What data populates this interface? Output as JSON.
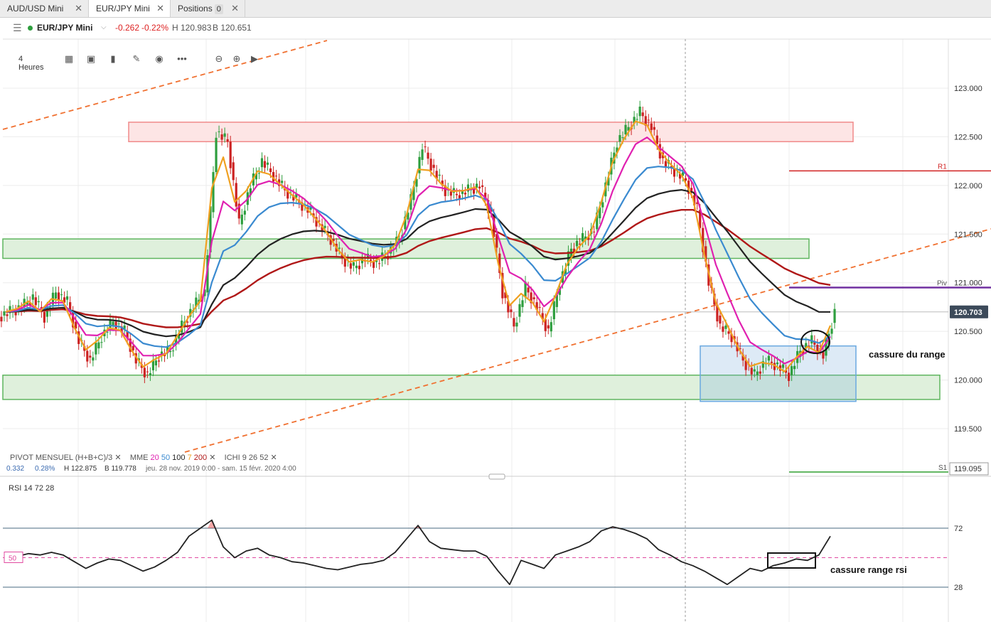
{
  "tabs": [
    {
      "label": "AUD/USD Mini",
      "active": false
    },
    {
      "label": "EUR/JPY Mini",
      "active": true
    },
    {
      "label": "Positions",
      "badge": "0",
      "active": false
    }
  ],
  "header": {
    "symbol": "EUR/JPY Mini",
    "change": "-0.262",
    "change_pct": "-0.22%",
    "high": "H 120.983",
    "bid": "B 120.651"
  },
  "toolbar": {
    "timeframe": "4 Heures",
    "icons": [
      "candles-icon",
      "layout-icon",
      "bar-chart-icon",
      "pencil-icon",
      "eye-icon",
      "more-icon",
      "zoom-out-icon",
      "zoom-in-icon",
      "play-icon"
    ]
  },
  "indicators": {
    "pivot": {
      "name": "PIVOT",
      "period": "MENSUEL",
      "formula": "(H+B+C)/3"
    },
    "mme": {
      "name": "MME",
      "periods": [
        "20",
        "50",
        "100",
        "7",
        "200"
      ]
    },
    "ichi": {
      "name": "ICHI",
      "params": [
        "9",
        "26",
        "52"
      ]
    },
    "rsi": {
      "name": "RSI",
      "params": [
        "14",
        "72",
        "28"
      ]
    }
  },
  "ohlc_line": {
    "val1": "0.332",
    "val2": "0.28%",
    "high": "H 122.875",
    "low": "B 119.778",
    "range": "jeu. 28 nov. 2019 0:00 - sam. 15 févr. 2020 4:00"
  },
  "colors": {
    "up": "#2e9e3e",
    "down": "#cc2222",
    "ema7": "#f0a020",
    "ema20": "#e020b0",
    "ema50": "#3a8ad0",
    "ema100": "#222222",
    "ema200": "#b01818",
    "pivot": "#7030a0",
    "r1": "#d02020",
    "s1": "#30a030",
    "trend": "#f07030"
  },
  "chart_data": {
    "type": "candlestick",
    "symbol": "EUR/JPY Mini",
    "timeframe": "4 Heures",
    "y_ticks": [
      123.0,
      122.5,
      122.0,
      121.5,
      121.0,
      120.5,
      120.0,
      119.5
    ],
    "y_tick_labels": [
      "123.000",
      "122.500",
      "122.000",
      "121.500",
      "121.000",
      "120.500",
      "120.000",
      "119.500"
    ],
    "ylim": [
      119.15,
      123.5
    ],
    "current_price": "120.703",
    "levels": {
      "R1": 122.15,
      "Piv": 120.95,
      "S1": 119.095
    },
    "level_labels": {
      "R1": "R1",
      "Piv": "Piv",
      "S1": "S1",
      "s1_value": "119.095"
    },
    "zones": [
      {
        "type": "resistance",
        "from": 122.45,
        "to": 122.65
      },
      {
        "type": "support",
        "from": 121.25,
        "to": 121.45
      },
      {
        "type": "support",
        "from": 119.8,
        "to": 120.05
      },
      {
        "type": "range",
        "from": 119.78,
        "to": 120.35
      }
    ],
    "closes": [
      120.7,
      120.75,
      120.85,
      120.65,
      120.9,
      120.8,
      120.4,
      120.2,
      120.45,
      120.6,
      120.5,
      120.2,
      120.05,
      120.25,
      120.3,
      120.55,
      120.75,
      120.9,
      122.55,
      122.45,
      121.6,
      122.0,
      122.25,
      122.1,
      121.95,
      121.85,
      121.75,
      121.6,
      121.45,
      121.25,
      121.15,
      121.25,
      121.2,
      121.3,
      121.45,
      121.85,
      122.4,
      122.15,
      121.95,
      121.9,
      121.95,
      122.0,
      121.7,
      120.9,
      120.55,
      120.95,
      120.75,
      120.5,
      121.0,
      121.35,
      121.45,
      121.55,
      122.0,
      122.45,
      122.6,
      122.75,
      122.6,
      122.25,
      122.15,
      122.05,
      121.75,
      121.0,
      120.55,
      120.45,
      120.2,
      120.05,
      120.2,
      120.15,
      120.05,
      120.3,
      120.4,
      120.25,
      120.7
    ],
    "annotations": [
      "cassure du range",
      "cassure range rsi"
    ],
    "rsi": {
      "levels": {
        "upper": 72,
        "middle": 50,
        "lower": 28
      },
      "labels": {
        "upper": "72",
        "middle": "50",
        "lower": "28"
      },
      "values": [
        49,
        51,
        53,
        52,
        54,
        52,
        47,
        42,
        46,
        49,
        48,
        44,
        40,
        43,
        48,
        54,
        66,
        72,
        78,
        58,
        50,
        55,
        57,
        52,
        50,
        47,
        46,
        44,
        42,
        41,
        43,
        45,
        46,
        48,
        54,
        64,
        74,
        62,
        57,
        56,
        55,
        55,
        51,
        40,
        30,
        48,
        45,
        42,
        52,
        55,
        58,
        62,
        70,
        73,
        71,
        68,
        64,
        56,
        52,
        47,
        44,
        40,
        35,
        30,
        36,
        42,
        40,
        44,
        46,
        49,
        48,
        52,
        66
      ]
    }
  }
}
